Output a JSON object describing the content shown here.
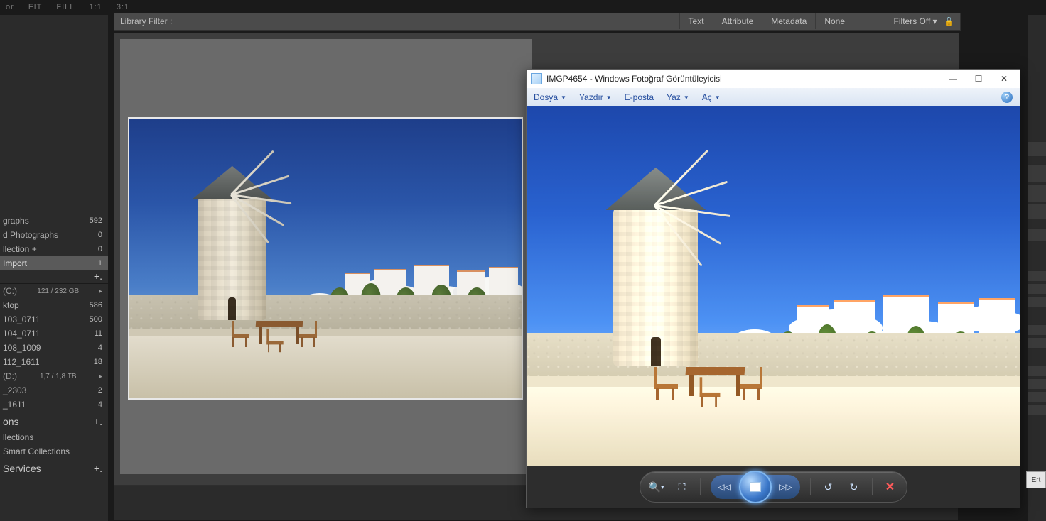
{
  "topbar": {
    "items": [
      "or",
      "FIT",
      "FILL",
      "1:1",
      "3:1"
    ]
  },
  "filterbar": {
    "label": "Library Filter :",
    "tabs": [
      "Text",
      "Attribute",
      "Metadata",
      "None"
    ],
    "filters_off": "Filters Off",
    "lock": "🔒"
  },
  "left": {
    "catalog": [
      {
        "label": "graphs",
        "count": "592"
      },
      {
        "label": "d Photographs",
        "count": "0"
      },
      {
        "label": "llection  +",
        "count": "0"
      },
      {
        "label": "Import",
        "count": "1",
        "selected": true
      }
    ],
    "folders": [
      {
        "label": "(C:)",
        "count": "121 / 232 GB",
        "head": true
      },
      {
        "label": "ktop",
        "count": "586"
      },
      {
        "label": "103_0711",
        "count": "500"
      },
      {
        "label": "104_0711",
        "count": "11"
      },
      {
        "label": "108_1009",
        "count": "4"
      },
      {
        "label": "112_1611",
        "count": "18"
      },
      {
        "label": "(D:)",
        "count": "1,7 / 1,8 TB",
        "head": true
      },
      {
        "label": "_2303",
        "count": "2"
      },
      {
        "label": "_1611",
        "count": "4"
      }
    ],
    "collections_title": "ons",
    "collections": [
      {
        "label": "llections"
      },
      {
        "label": "Smart Collections"
      }
    ],
    "services_title": "Services"
  },
  "wpv": {
    "title": "IMGP4654 - Windows Fotoğraf Görüntüleyicisi",
    "menu": [
      "Dosya",
      "Yazdır",
      "E-posta",
      "Yaz",
      "Aç"
    ],
    "menu_dd": [
      true,
      true,
      false,
      true,
      true
    ],
    "win_btns": {
      "min": "—",
      "max": "☐",
      "close": "✕"
    },
    "help": "?",
    "ctrl": {
      "zoom": "🔍",
      "zoom_dd": "▾",
      "fit": "⛶",
      "prev": "◁◁",
      "next": "▷▷",
      "rot_l": "↺",
      "rot_r": "↻",
      "del": "✕"
    }
  },
  "ert": "Ert"
}
